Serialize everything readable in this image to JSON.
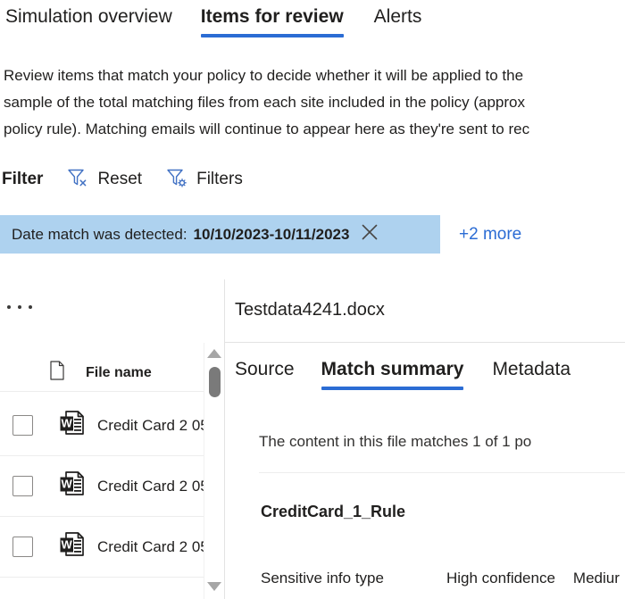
{
  "tabs": [
    {
      "label": "Simulation overview",
      "active": false
    },
    {
      "label": "Items for review",
      "active": true
    },
    {
      "label": "Alerts",
      "active": false
    }
  ],
  "description": "Review items that match your policy to decide whether it will be applied to the\nsample of the total matching files from each site included in the policy (approx\npolicy rule). Matching emails will continue to appear here as they're sent to rec",
  "filter_bar": {
    "label": "Filter",
    "reset_label": "Reset",
    "reset_icon": "funnel-clear-icon",
    "filters_label": "Filters",
    "filters_icon": "funnel-settings-icon"
  },
  "applied_filter": {
    "name": "Date match was detected:",
    "value": "10/10/2023-10/11/2023",
    "remove_icon": "close-icon",
    "more_label": "+2 more",
    "pill_color": "#aed2ef",
    "link_color": "#2b6cd4"
  },
  "list_panel": {
    "overflow_icon": "more-options-icon",
    "header": {
      "file_icon": "document-icon",
      "filename_label": "File name"
    },
    "rows": [
      {
        "icon": "word-document-icon",
        "filename": "Credit Card 2 05"
      },
      {
        "icon": "word-document-icon",
        "filename": "Credit Card 2 05"
      },
      {
        "icon": "word-document-icon",
        "filename": "Credit Card 2 05"
      }
    ],
    "scrollbar": {
      "up_icon": "scroll-up-arrow-icon",
      "down_icon": "scroll-down-arrow-icon"
    }
  },
  "detail_panel": {
    "title": "Testdata4241.docx",
    "tabs": [
      {
        "label": "Source",
        "active": false
      },
      {
        "label": "Match summary",
        "active": true
      },
      {
        "label": "Metadata",
        "active": false
      }
    ],
    "match_intro": "The content in this file matches 1 of 1 po",
    "rule_name": "CreditCard_1_Rule",
    "table_headers": {
      "sensitive_info_type": "Sensitive info type",
      "high_confidence": "High confidence",
      "medium_confidence": "Mediur"
    }
  },
  "accent_color": "#2b6cd4"
}
